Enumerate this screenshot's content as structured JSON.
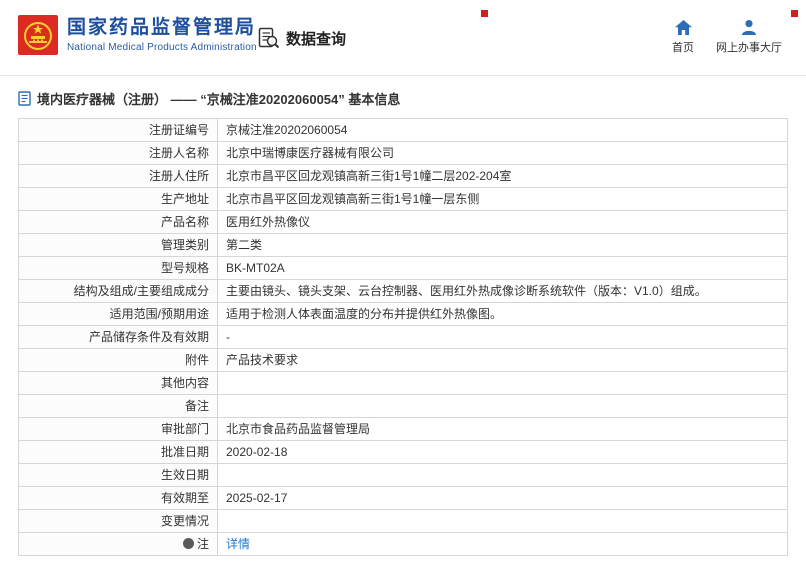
{
  "header": {
    "agency_cn": "国家药品监督管理局",
    "agency_en": "National Medical Products Administration",
    "nav_search": "数据查询",
    "nav_home": "首页",
    "nav_hall": "网上办事大厅",
    "brand_color": "#1e4f9c",
    "emblem_red": "#dd2a22",
    "emblem_gold": "#fccf2f",
    "marker_red": "#d0211c"
  },
  "breadcrumb": {
    "text": "境内医疗器械（注册） —— “京械注准20202060054” 基本信息"
  },
  "table": {
    "rows": [
      {
        "label": "注册证编号",
        "value": "京械注准20202060054"
      },
      {
        "label": "注册人名称",
        "value": "北京中瑞博康医疗器械有限公司"
      },
      {
        "label": "注册人住所",
        "value": "北京市昌平区回龙观镇高新三街1号1幢二层202-204室"
      },
      {
        "label": "生产地址",
        "value": "北京市昌平区回龙观镇高新三街1号1幢一层东侧"
      },
      {
        "label": "产品名称",
        "value": "医用红外热像仪"
      },
      {
        "label": "管理类别",
        "value": "第二类"
      },
      {
        "label": "型号规格",
        "value": "BK-MT02A"
      },
      {
        "label": "结构及组成/主要组成成分",
        "value": "主要由镜头、镜头支架、云台控制器、医用红外热成像诊断系统软件（版本：V1.0）组成。"
      },
      {
        "label": "适用范围/预期用途",
        "value": "适用于检测人体表面温度的分布并提供红外热像图。"
      },
      {
        "label": "产品储存条件及有效期",
        "value": "-"
      },
      {
        "label": "附件",
        "value": "产品技术要求"
      },
      {
        "label": "其他内容",
        "value": ""
      },
      {
        "label": "备注",
        "value": ""
      },
      {
        "label": "审批部门",
        "value": "北京市食品药品监督管理局"
      },
      {
        "label": "批准日期",
        "value": "2020-02-18"
      },
      {
        "label": "生效日期",
        "value": ""
      },
      {
        "label": "有效期至",
        "value": "2025-02-17"
      },
      {
        "label": "变更情况",
        "value": ""
      },
      {
        "label": "注",
        "value": "详情",
        "link": true,
        "icon": "note-icon"
      }
    ]
  }
}
